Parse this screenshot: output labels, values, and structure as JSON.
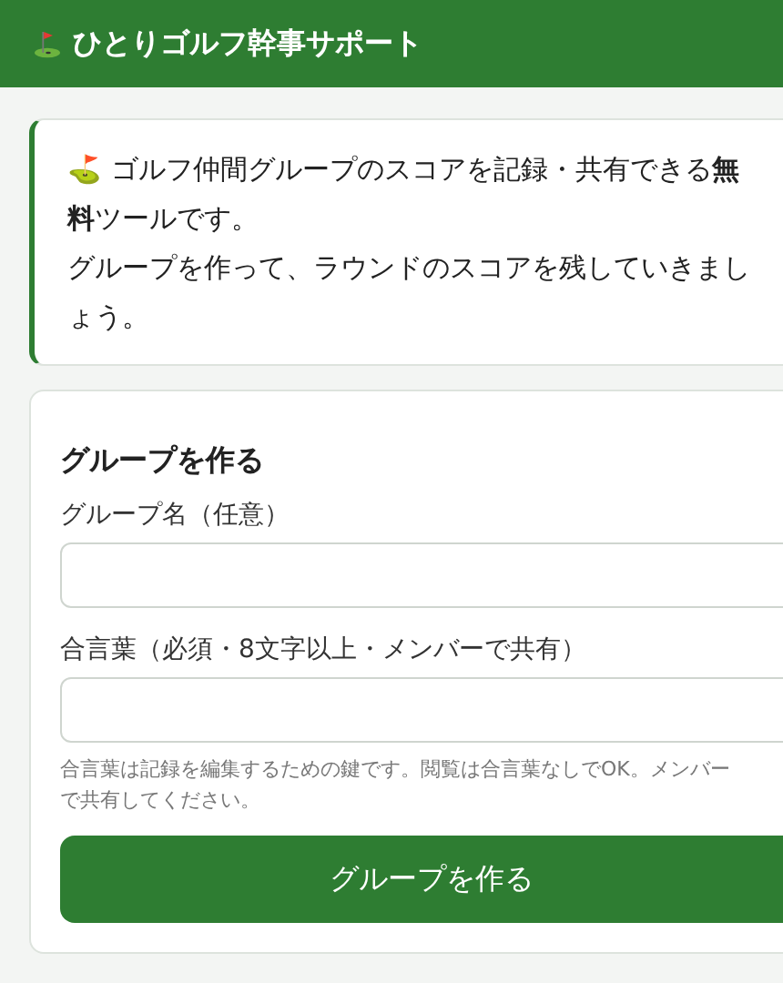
{
  "header": {
    "title": "ひとりゴルフ幹事サポート"
  },
  "intro": {
    "paragraphs": [
      "⛳ ゴルフ仲間グループのスコアを記録・共有できる**無料**ツールです。",
      "グループを作って、ラウンドのスコアを残していきましょう。"
    ]
  },
  "form": {
    "title": "グループを作る",
    "fields": [
      {
        "label": "グループ名（任意）"
      },
      {
        "label": "合言葉（必須・8文字以上・メンバーで共有）"
      }
    ],
    "note": "合言葉は記録を編集するための鍵です。閲覧は合言葉なしでOK。メンバーで共有してください。",
    "button": "グループを作る"
  }
}
